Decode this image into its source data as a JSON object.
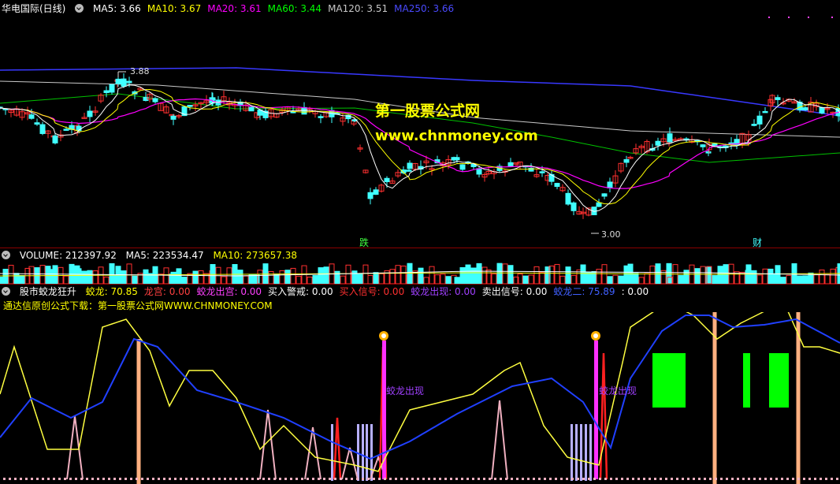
{
  "main_panel": {
    "stock_name": "华电国际(日线)",
    "ma": [
      {
        "label": "MA5: 3.66",
        "color": "#ffffff"
      },
      {
        "label": "MA10: 3.67",
        "color": "#ffff00"
      },
      {
        "label": "MA20: 3.61",
        "color": "#ff00ff"
      },
      {
        "label": "MA60: 3.44",
        "color": "#00ff00"
      },
      {
        "label": "MA120: 3.51",
        "color": "#c8c8c8"
      },
      {
        "label": "MA250: 3.66",
        "color": "#4a4aff"
      }
    ],
    "high_marker": "3.88",
    "low_marker": "3.00",
    "signal_die": "跌",
    "signal_cai": "财",
    "watermark_cn": "第一股票公式网",
    "watermark_url": "www.chnmoney.com"
  },
  "volume_panel": {
    "title": "VOLUME: 212397.92",
    "ma5": "MA5: 223534.47",
    "ma10": "MA10: 273657.38"
  },
  "indicator_panel": {
    "name": "股市蛟龙狂升",
    "items": [
      {
        "label": "蛟龙: 70.85",
        "color": "#ffff00"
      },
      {
        "label": "龙宫: 0.00",
        "color": "#ff4040"
      },
      {
        "label": "蛟龙出宫: 0.00",
        "color": "#ff40ff"
      },
      {
        "label": "买入警戒: 0.00",
        "color": "#ffffff"
      },
      {
        "label": "买入信号: 0.00",
        "color": "#ff3030"
      },
      {
        "label": "蛟龙出现: 0.00",
        "color": "#a040ff"
      },
      {
        "label": "卖出信号: 0.00",
        "color": "#ffffff"
      },
      {
        "label": "蛟龙二: 75.89",
        "color": "#4060ff"
      },
      {
        "label": ": 0.00",
        "color": "#ffffff"
      }
    ],
    "subtitle": "通达信原创公式下载：第一股票公式网WWW.CHNMONEY.COM",
    "appear_label_1": "蛟龙出现",
    "appear_label_2": "蛟龙出现"
  }
}
